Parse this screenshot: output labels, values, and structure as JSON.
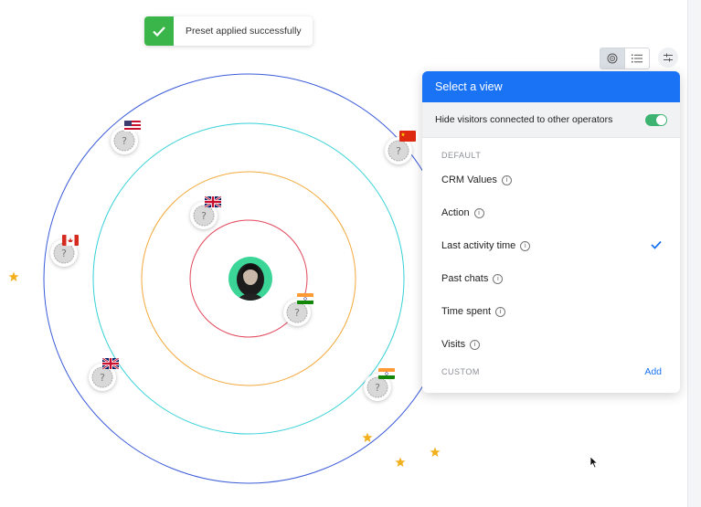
{
  "toast": {
    "message": "Preset applied successfully",
    "color": "#39b54a"
  },
  "toolbar": {
    "orbit_view_icon": "orbit-icon",
    "list_view_icon": "list-icon",
    "filter_icon": "filter-icon"
  },
  "panel": {
    "title": "Select a view",
    "hide_visitors_label": "Hide visitors connected to other operators",
    "hide_visitors_enabled": true,
    "default_label": "DEFAULT",
    "options": [
      {
        "label": "CRM Values",
        "selected": false
      },
      {
        "label": "Action",
        "selected": false
      },
      {
        "label": "Last activity time",
        "selected": true
      },
      {
        "label": "Past chats",
        "selected": false
      },
      {
        "label": "Time spent",
        "selected": false
      },
      {
        "label": "Visits",
        "selected": false
      }
    ],
    "custom_label": "CUSTOM",
    "add_label": "Add",
    "accent": "#1a73f5"
  },
  "visitors": [
    {
      "flag": "us",
      "ring": "outer"
    },
    {
      "flag": "cn",
      "ring": "outer"
    },
    {
      "flag": "ca",
      "ring": "outer"
    },
    {
      "flag": "gb",
      "ring": "outer"
    },
    {
      "flag": "gb",
      "ring": "middle"
    },
    {
      "flag": "in",
      "ring": "inner"
    },
    {
      "flag": "in",
      "ring": "outer"
    }
  ],
  "ring_colors": {
    "outer": "#3a5bd9",
    "second": "#35d1d8",
    "third": "#f2a93b",
    "inner": "#e0475a"
  }
}
